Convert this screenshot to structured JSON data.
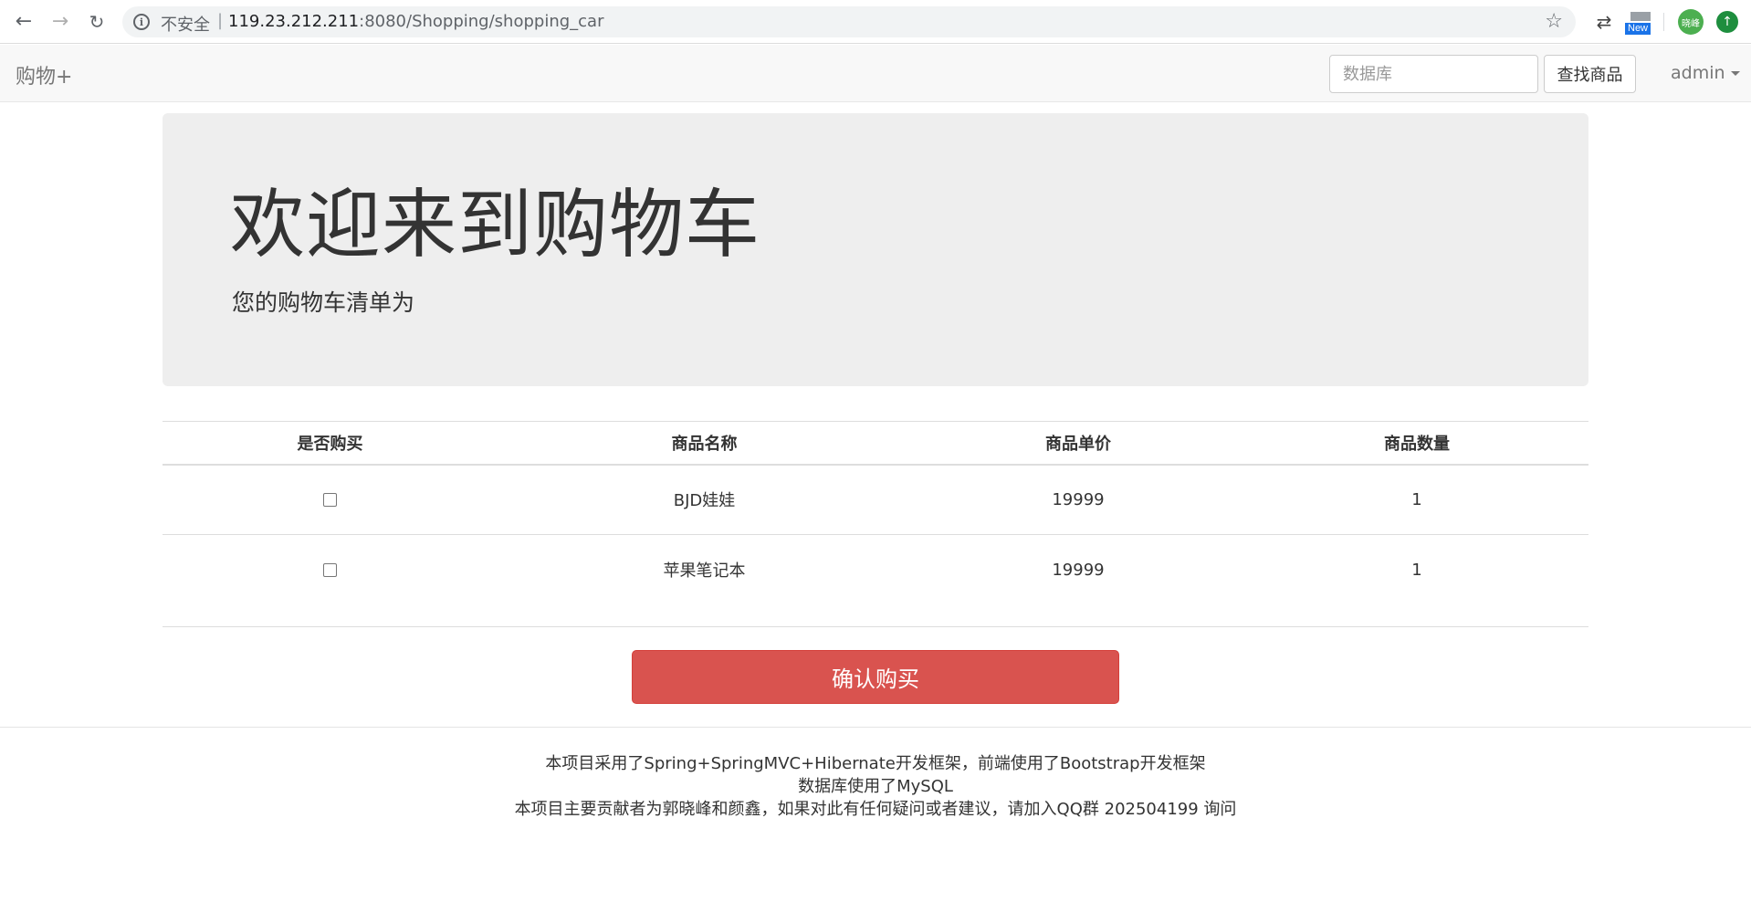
{
  "browser": {
    "security_label": "不安全",
    "separator": "|",
    "url_host": "119.23.212.211",
    "url_rest": ":8080/Shopping/shopping_car",
    "extension_new_label": "New",
    "avatar_label": "晓峰"
  },
  "navbar": {
    "brand": "购物+",
    "search_placeholder": "数据库",
    "search_button": "查找商品",
    "user": "admin"
  },
  "jumbotron": {
    "title": "欢迎来到购物车",
    "subtitle": "您的购物车清单为"
  },
  "table": {
    "headers": [
      "是否购买",
      "商品名称",
      "商品单价",
      "商品数量"
    ],
    "rows": [
      {
        "selected": false,
        "name": "BJD娃娃",
        "price": "19999",
        "quantity": "1"
      },
      {
        "selected": false,
        "name": "苹果笔记本",
        "price": "19999",
        "quantity": "1"
      }
    ]
  },
  "confirm_button": "确认购买",
  "footer": {
    "line1": "本项目采用了Spring+SpringMVC+Hibernate开发框架，前端使用了Bootstrap开发框架",
    "line2": "数据库使用了MySQL",
    "line3": "本项目主要贡献者为郭晓峰和颜鑫，如果对此有任何疑问或者建议，请加入QQ群 202504199 询问"
  },
  "colors": {
    "navbar_bg": "#f8f8f8",
    "jumbotron_bg": "#eeeeee",
    "danger": "#d9534f"
  }
}
